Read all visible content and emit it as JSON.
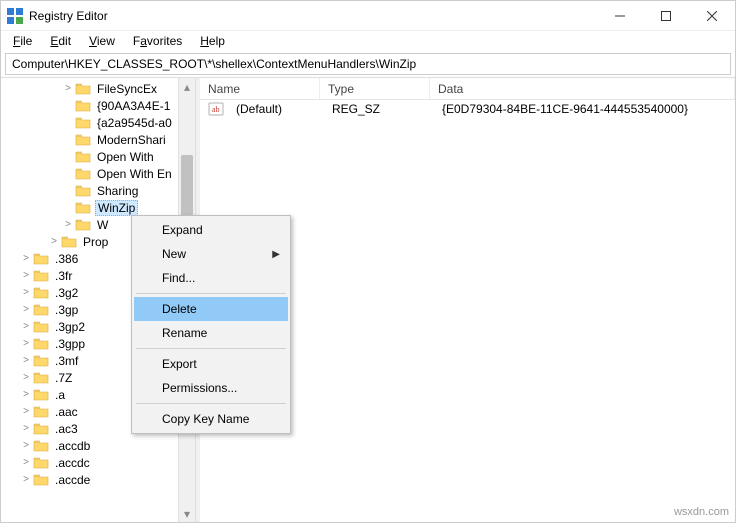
{
  "window": {
    "title": "Registry Editor"
  },
  "menu": {
    "file": "File",
    "edit": "Edit",
    "view": "View",
    "favorites": "Favorites",
    "help": "Help"
  },
  "address": "Computer\\HKEY_CLASSES_ROOT\\*\\shellex\\ContextMenuHandlers\\WinZip",
  "tree": [
    {
      "indent": 4,
      "expander": ">",
      "label": "FileSyncEx"
    },
    {
      "indent": 4,
      "expander": "",
      "label": "{90AA3A4E-1"
    },
    {
      "indent": 4,
      "expander": "",
      "label": "{a2a9545d-a0"
    },
    {
      "indent": 4,
      "expander": "",
      "label": "ModernShari"
    },
    {
      "indent": 4,
      "expander": "",
      "label": "Open With"
    },
    {
      "indent": 4,
      "expander": "",
      "label": "Open With En"
    },
    {
      "indent": 4,
      "expander": "",
      "label": "Sharing"
    },
    {
      "indent": 4,
      "expander": "",
      "label": "WinZip",
      "selected": true
    },
    {
      "indent": 4,
      "expander": ">",
      "label": "W"
    },
    {
      "indent": 3,
      "expander": ">",
      "label": "Prop"
    },
    {
      "indent": 1,
      "expander": ">",
      "label": ".386"
    },
    {
      "indent": 1,
      "expander": ">",
      "label": ".3fr"
    },
    {
      "indent": 1,
      "expander": ">",
      "label": ".3g2"
    },
    {
      "indent": 1,
      "expander": ">",
      "label": ".3gp"
    },
    {
      "indent": 1,
      "expander": ">",
      "label": ".3gp2"
    },
    {
      "indent": 1,
      "expander": ">",
      "label": ".3gpp"
    },
    {
      "indent": 1,
      "expander": ">",
      "label": ".3mf"
    },
    {
      "indent": 1,
      "expander": ">",
      "label": ".7Z"
    },
    {
      "indent": 1,
      "expander": ">",
      "label": ".a"
    },
    {
      "indent": 1,
      "expander": ">",
      "label": ".aac"
    },
    {
      "indent": 1,
      "expander": ">",
      "label": ".ac3"
    },
    {
      "indent": 1,
      "expander": ">",
      "label": ".accdb"
    },
    {
      "indent": 1,
      "expander": ">",
      "label": ".accdc"
    },
    {
      "indent": 1,
      "expander": ">",
      "label": ".accde"
    }
  ],
  "list": {
    "cols": {
      "name": "Name",
      "type": "Type",
      "data": "Data"
    },
    "rows": [
      {
        "name": "(Default)",
        "type": "REG_SZ",
        "data": "{E0D79304-84BE-11CE-9641-444553540000}"
      }
    ]
  },
  "context_menu": {
    "expand": "Expand",
    "new": "New",
    "find": "Find...",
    "delete": "Delete",
    "rename": "Rename",
    "export": "Export",
    "permissions": "Permissions...",
    "copy_key_name": "Copy Key Name"
  },
  "watermark": "wsxdn.com"
}
